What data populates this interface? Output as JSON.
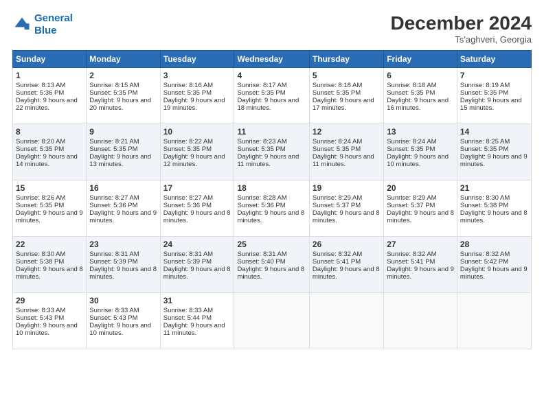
{
  "header": {
    "logo_line1": "General",
    "logo_line2": "Blue",
    "month": "December 2024",
    "location": "Ts'aghveri, Georgia"
  },
  "days_of_week": [
    "Sunday",
    "Monday",
    "Tuesday",
    "Wednesday",
    "Thursday",
    "Friday",
    "Saturday"
  ],
  "weeks": [
    [
      {
        "day": "1",
        "sunrise": "8:13 AM",
        "sunset": "5:36 PM",
        "daylight": "9 hours and 22 minutes."
      },
      {
        "day": "2",
        "sunrise": "8:15 AM",
        "sunset": "5:35 PM",
        "daylight": "9 hours and 20 minutes."
      },
      {
        "day": "3",
        "sunrise": "8:16 AM",
        "sunset": "5:35 PM",
        "daylight": "9 hours and 19 minutes."
      },
      {
        "day": "4",
        "sunrise": "8:17 AM",
        "sunset": "5:35 PM",
        "daylight": "9 hours and 18 minutes."
      },
      {
        "day": "5",
        "sunrise": "8:18 AM",
        "sunset": "5:35 PM",
        "daylight": "9 hours and 17 minutes."
      },
      {
        "day": "6",
        "sunrise": "8:18 AM",
        "sunset": "5:35 PM",
        "daylight": "9 hours and 16 minutes."
      },
      {
        "day": "7",
        "sunrise": "8:19 AM",
        "sunset": "5:35 PM",
        "daylight": "9 hours and 15 minutes."
      }
    ],
    [
      {
        "day": "8",
        "sunrise": "8:20 AM",
        "sunset": "5:35 PM",
        "daylight": "9 hours and 14 minutes."
      },
      {
        "day": "9",
        "sunrise": "8:21 AM",
        "sunset": "5:35 PM",
        "daylight": "9 hours and 13 minutes."
      },
      {
        "day": "10",
        "sunrise": "8:22 AM",
        "sunset": "5:35 PM",
        "daylight": "9 hours and 12 minutes."
      },
      {
        "day": "11",
        "sunrise": "8:23 AM",
        "sunset": "5:35 PM",
        "daylight": "9 hours and 11 minutes."
      },
      {
        "day": "12",
        "sunrise": "8:24 AM",
        "sunset": "5:35 PM",
        "daylight": "9 hours and 11 minutes."
      },
      {
        "day": "13",
        "sunrise": "8:24 AM",
        "sunset": "5:35 PM",
        "daylight": "9 hours and 10 minutes."
      },
      {
        "day": "14",
        "sunrise": "8:25 AM",
        "sunset": "5:35 PM",
        "daylight": "9 hours and 9 minutes."
      }
    ],
    [
      {
        "day": "15",
        "sunrise": "8:26 AM",
        "sunset": "5:35 PM",
        "daylight": "9 hours and 9 minutes."
      },
      {
        "day": "16",
        "sunrise": "8:27 AM",
        "sunset": "5:36 PM",
        "daylight": "9 hours and 9 minutes."
      },
      {
        "day": "17",
        "sunrise": "8:27 AM",
        "sunset": "5:36 PM",
        "daylight": "9 hours and 8 minutes."
      },
      {
        "day": "18",
        "sunrise": "8:28 AM",
        "sunset": "5:36 PM",
        "daylight": "9 hours and 8 minutes."
      },
      {
        "day": "19",
        "sunrise": "8:29 AM",
        "sunset": "5:37 PM",
        "daylight": "9 hours and 8 minutes."
      },
      {
        "day": "20",
        "sunrise": "8:29 AM",
        "sunset": "5:37 PM",
        "daylight": "9 hours and 8 minutes."
      },
      {
        "day": "21",
        "sunrise": "8:30 AM",
        "sunset": "5:38 PM",
        "daylight": "9 hours and 8 minutes."
      }
    ],
    [
      {
        "day": "22",
        "sunrise": "8:30 AM",
        "sunset": "5:38 PM",
        "daylight": "9 hours and 8 minutes."
      },
      {
        "day": "23",
        "sunrise": "8:31 AM",
        "sunset": "5:39 PM",
        "daylight": "9 hours and 8 minutes."
      },
      {
        "day": "24",
        "sunrise": "8:31 AM",
        "sunset": "5:39 PM",
        "daylight": "9 hours and 8 minutes."
      },
      {
        "day": "25",
        "sunrise": "8:31 AM",
        "sunset": "5:40 PM",
        "daylight": "9 hours and 8 minutes."
      },
      {
        "day": "26",
        "sunrise": "8:32 AM",
        "sunset": "5:41 PM",
        "daylight": "9 hours and 8 minutes."
      },
      {
        "day": "27",
        "sunrise": "8:32 AM",
        "sunset": "5:41 PM",
        "daylight": "9 hours and 9 minutes."
      },
      {
        "day": "28",
        "sunrise": "8:32 AM",
        "sunset": "5:42 PM",
        "daylight": "9 hours and 9 minutes."
      }
    ],
    [
      {
        "day": "29",
        "sunrise": "8:33 AM",
        "sunset": "5:43 PM",
        "daylight": "9 hours and 10 minutes."
      },
      {
        "day": "30",
        "sunrise": "8:33 AM",
        "sunset": "5:43 PM",
        "daylight": "9 hours and 10 minutes."
      },
      {
        "day": "31",
        "sunrise": "8:33 AM",
        "sunset": "5:44 PM",
        "daylight": "9 hours and 11 minutes."
      },
      null,
      null,
      null,
      null
    ]
  ]
}
